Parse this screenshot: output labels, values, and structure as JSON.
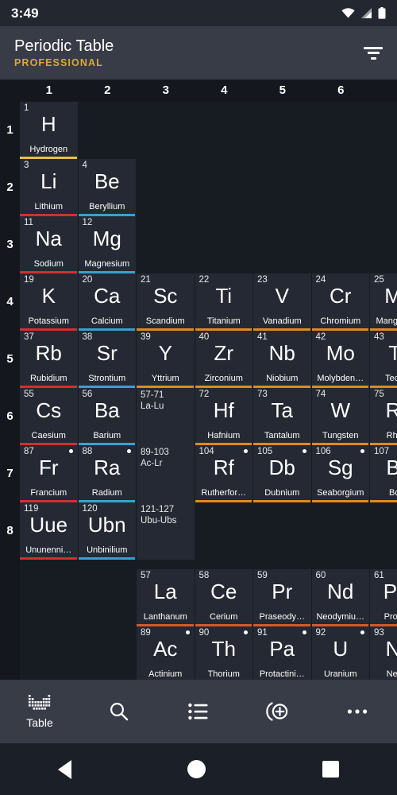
{
  "status": {
    "time": "3:49",
    "icons": [
      "wifi-icon",
      "cellular-icon",
      "battery-icon"
    ]
  },
  "appbar": {
    "title": "Periodic Table",
    "subtitle": "PROFESSIONAL",
    "filter_icon": "filter-icon",
    "accent_color": "#d8a93a",
    "background": "#383c47"
  },
  "table": {
    "column_headers": [
      "1",
      "2",
      "3",
      "4",
      "5",
      "6"
    ],
    "row_headers": [
      "1",
      "2",
      "3",
      "4",
      "5",
      "6",
      "7",
      "8"
    ],
    "category_colors": {
      "nonmetal": "#e8c23a",
      "alkali_metal": "#d32f2f",
      "alkaline_earth": "#3a9fd0",
      "transition_metal": "#e08a1e",
      "lanthanide": "#d45a2a",
      "actinide": "#4a7a3a"
    },
    "cells": [
      {
        "num": "1",
        "sym": "H",
        "name": "Hydrogen",
        "col": 1,
        "row": 1,
        "cat": "nonmetal",
        "radioactive": false
      },
      {
        "num": "3",
        "sym": "Li",
        "name": "Lithium",
        "col": 1,
        "row": 2,
        "cat": "alkali_metal",
        "radioactive": false
      },
      {
        "num": "4",
        "sym": "Be",
        "name": "Beryllium",
        "col": 2,
        "row": 2,
        "cat": "alkaline_earth",
        "radioactive": false
      },
      {
        "num": "11",
        "sym": "Na",
        "name": "Sodium",
        "col": 1,
        "row": 3,
        "cat": "alkali_metal",
        "radioactive": false
      },
      {
        "num": "12",
        "sym": "Mg",
        "name": "Magnesium",
        "col": 2,
        "row": 3,
        "cat": "alkaline_earth",
        "radioactive": false
      },
      {
        "num": "19",
        "sym": "K",
        "name": "Potassium",
        "col": 1,
        "row": 4,
        "cat": "alkali_metal",
        "radioactive": false
      },
      {
        "num": "20",
        "sym": "Ca",
        "name": "Calcium",
        "col": 2,
        "row": 4,
        "cat": "alkaline_earth",
        "radioactive": false
      },
      {
        "num": "21",
        "sym": "Sc",
        "name": "Scandium",
        "col": 3,
        "row": 4,
        "cat": "transition_metal",
        "radioactive": false
      },
      {
        "num": "22",
        "sym": "Ti",
        "name": "Titanium",
        "col": 4,
        "row": 4,
        "cat": "transition_metal",
        "radioactive": false
      },
      {
        "num": "23",
        "sym": "V",
        "name": "Vanadium",
        "col": 5,
        "row": 4,
        "cat": "transition_metal",
        "radioactive": false
      },
      {
        "num": "24",
        "sym": "Cr",
        "name": "Chromium",
        "col": 6,
        "row": 4,
        "cat": "transition_metal",
        "radioactive": false
      },
      {
        "num": "25",
        "sym": "Mn",
        "name": "Manganese",
        "col": 7,
        "row": 4,
        "cat": "transition_metal",
        "radioactive": false
      },
      {
        "num": "37",
        "sym": "Rb",
        "name": "Rubidium",
        "col": 1,
        "row": 5,
        "cat": "alkali_metal",
        "radioactive": false
      },
      {
        "num": "38",
        "sym": "Sr",
        "name": "Strontium",
        "col": 2,
        "row": 5,
        "cat": "alkaline_earth",
        "radioactive": false
      },
      {
        "num": "39",
        "sym": "Y",
        "name": "Yttrium",
        "col": 3,
        "row": 5,
        "cat": "transition_metal",
        "radioactive": false
      },
      {
        "num": "40",
        "sym": "Zr",
        "name": "Zirconium",
        "col": 4,
        "row": 5,
        "cat": "transition_metal",
        "radioactive": false
      },
      {
        "num": "41",
        "sym": "Nb",
        "name": "Niobium",
        "col": 5,
        "row": 5,
        "cat": "transition_metal",
        "radioactive": false
      },
      {
        "num": "42",
        "sym": "Mo",
        "name": "Molybden…",
        "col": 6,
        "row": 5,
        "cat": "transition_metal",
        "radioactive": false
      },
      {
        "num": "43",
        "sym": "Tc",
        "name": "Tech…",
        "col": 7,
        "row": 5,
        "cat": "transition_metal",
        "radioactive": true
      },
      {
        "num": "55",
        "sym": "Cs",
        "name": "Caesium",
        "col": 1,
        "row": 6,
        "cat": "alkali_metal",
        "radioactive": false
      },
      {
        "num": "56",
        "sym": "Ba",
        "name": "Barium",
        "col": 2,
        "row": 6,
        "cat": "alkaline_earth",
        "radioactive": false
      },
      {
        "num": "72",
        "sym": "Hf",
        "name": "Hafnium",
        "col": 4,
        "row": 6,
        "cat": "transition_metal",
        "radioactive": false
      },
      {
        "num": "73",
        "sym": "Ta",
        "name": "Tantalum",
        "col": 5,
        "row": 6,
        "cat": "transition_metal",
        "radioactive": false
      },
      {
        "num": "74",
        "sym": "W",
        "name": "Tungsten",
        "col": 6,
        "row": 6,
        "cat": "transition_metal",
        "radioactive": false
      },
      {
        "num": "75",
        "sym": "Re",
        "name": "Rhe…",
        "col": 7,
        "row": 6,
        "cat": "transition_metal",
        "radioactive": false
      },
      {
        "num": "87",
        "sym": "Fr",
        "name": "Francium",
        "col": 1,
        "row": 7,
        "cat": "alkali_metal",
        "radioactive": true
      },
      {
        "num": "88",
        "sym": "Ra",
        "name": "Radium",
        "col": 2,
        "row": 7,
        "cat": "alkaline_earth",
        "radioactive": true
      },
      {
        "num": "104",
        "sym": "Rf",
        "name": "Rutherfor…",
        "col": 4,
        "row": 7,
        "cat": "transition_metal",
        "radioactive": true
      },
      {
        "num": "105",
        "sym": "Db",
        "name": "Dubnium",
        "col": 5,
        "row": 7,
        "cat": "transition_metal",
        "radioactive": true
      },
      {
        "num": "106",
        "sym": "Sg",
        "name": "Seaborgium",
        "col": 6,
        "row": 7,
        "cat": "transition_metal",
        "radioactive": true
      },
      {
        "num": "107",
        "sym": "Bh",
        "name": "Bo…",
        "col": 7,
        "row": 7,
        "cat": "transition_metal",
        "radioactive": true
      },
      {
        "num": "119",
        "sym": "Uue",
        "name": "Ununenni…",
        "col": 1,
        "row": 8,
        "cat": "alkali_metal",
        "radioactive": false
      },
      {
        "num": "120",
        "sym": "Ubn",
        "name": "Unbinilium",
        "col": 2,
        "row": 8,
        "cat": "alkaline_earth",
        "radioactive": false
      }
    ],
    "range_cells": [
      {
        "range": "57-71",
        "label": "La-Lu",
        "col": 3,
        "row": 6
      },
      {
        "range": "89-103",
        "label": "Ac-Lr",
        "col": 3,
        "row": 7
      },
      {
        "range": "121-127",
        "label": "Ubu-Ubs",
        "col": 3,
        "row": 8
      }
    ],
    "lanthanides": [
      {
        "num": "57",
        "sym": "La",
        "name": "Lanthanum",
        "col": 3,
        "cat": "lanthanide",
        "radioactive": false
      },
      {
        "num": "58",
        "sym": "Ce",
        "name": "Cerium",
        "col": 4,
        "cat": "lanthanide",
        "radioactive": false
      },
      {
        "num": "59",
        "sym": "Pr",
        "name": "Praseody…",
        "col": 5,
        "cat": "lanthanide",
        "radioactive": false
      },
      {
        "num": "60",
        "sym": "Nd",
        "name": "Neodymiu…",
        "col": 6,
        "cat": "lanthanide",
        "radioactive": false
      },
      {
        "num": "61",
        "sym": "Pm",
        "name": "Prom…",
        "col": 7,
        "cat": "lanthanide",
        "radioactive": true
      }
    ],
    "actinides": [
      {
        "num": "89",
        "sym": "Ac",
        "name": "Actinium",
        "col": 3,
        "cat": "actinide",
        "radioactive": true
      },
      {
        "num": "90",
        "sym": "Th",
        "name": "Thorium",
        "col": 4,
        "cat": "actinide",
        "radioactive": true
      },
      {
        "num": "91",
        "sym": "Pa",
        "name": "Protactini…",
        "col": 5,
        "cat": "actinide",
        "radioactive": true
      },
      {
        "num": "92",
        "sym": "U",
        "name": "Uranium",
        "col": 6,
        "cat": "actinide",
        "radioactive": true
      },
      {
        "num": "93",
        "sym": "Np",
        "name": "Nep…",
        "col": 7,
        "cat": "actinide",
        "radioactive": true
      }
    ]
  },
  "bottomnav": {
    "items": [
      {
        "icon": "periodic-table-icon",
        "label": "Table",
        "active": true
      },
      {
        "icon": "search-icon",
        "label": "",
        "active": false
      },
      {
        "icon": "list-icon",
        "label": "",
        "active": false
      },
      {
        "icon": "isotopes-add-icon",
        "label": "",
        "active": false
      },
      {
        "icon": "overflow-menu-icon",
        "label": "",
        "active": false
      }
    ]
  },
  "androidnav": {
    "back": "back-button",
    "home": "home-button",
    "recents": "recents-button"
  }
}
